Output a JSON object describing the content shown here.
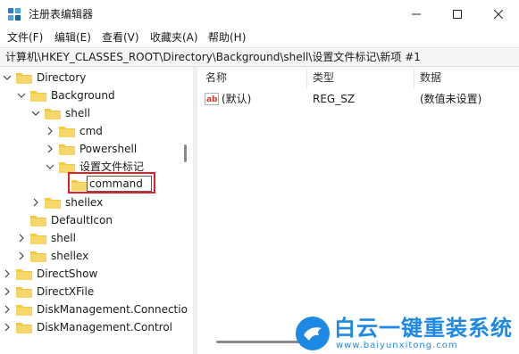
{
  "window": {
    "title": "注册表编辑器",
    "controls": {
      "minimize": "—",
      "maximize": "☐",
      "close": "✕"
    }
  },
  "menu": [
    "文件(F)",
    "编辑(E)",
    "查看(V)",
    "收藏夹(A)",
    "帮助(H)"
  ],
  "address": "计算机\\HKEY_CLASSES_ROOT\\Directory\\Background\\shell\\设置文件标记\\新项 #1",
  "tree": [
    {
      "label": "Directory",
      "expanded": true
    },
    {
      "label": "Background",
      "expanded": true
    },
    {
      "label": "shell",
      "expanded": true
    },
    {
      "label": "cmd",
      "expanded": false
    },
    {
      "label": "Powershell",
      "expanded": false
    },
    {
      "label": "设置文件标记",
      "expanded": true
    },
    {
      "label": "command",
      "editing": true
    },
    {
      "label": "shellex",
      "expanded": false
    },
    {
      "label": "DefaultIcon"
    },
    {
      "label": "shell",
      "expanded": false
    },
    {
      "label": "shellex",
      "expanded": false
    },
    {
      "label": "DirectShow",
      "expanded": false
    },
    {
      "label": "DirectXFile",
      "expanded": false
    },
    {
      "label": "DiskManagement.Connectio",
      "expanded": false
    },
    {
      "label": "DiskManagement.Control",
      "expanded": false
    }
  ],
  "columns": [
    "名称",
    "类型",
    "数据"
  ],
  "values": [
    {
      "name": "(默认)",
      "type": "REG_SZ",
      "data": "(数值未设置)",
      "icon": "ab-string-icon"
    }
  ],
  "watermark": {
    "title": "白云一键重装系统",
    "url": "www.baiyunxitong.com"
  },
  "colors": {
    "folder": "#f2c744",
    "highlight": "#e0202a",
    "brand_blue": "#1e88e5"
  }
}
